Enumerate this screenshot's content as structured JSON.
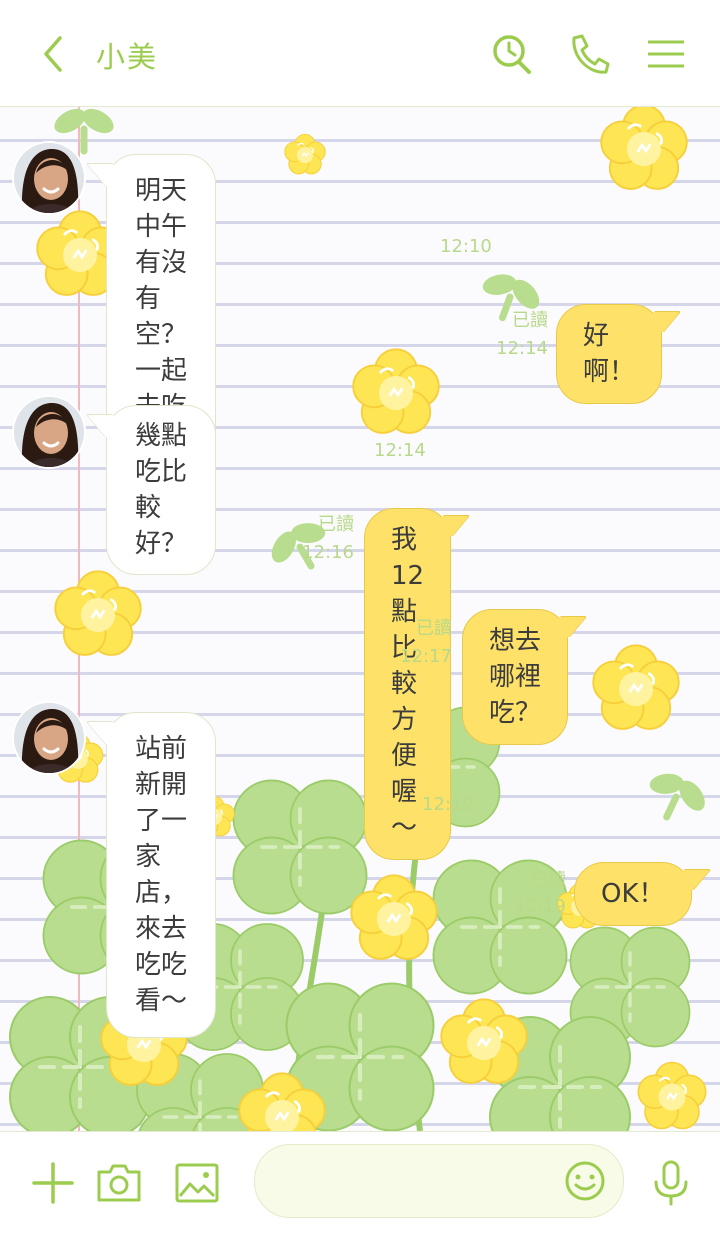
{
  "header": {
    "title": "小美",
    "back_icon": "chevron-left-icon",
    "search_icon": "search-clock-icon",
    "call_icon": "phone-icon",
    "menu_icon": "hamburger-menu-icon"
  },
  "messages": [
    {
      "from": "friend",
      "text": "明天中午有沒有空？\n一起去吃好吃的吧～",
      "time": "12:10"
    },
    {
      "from": "me",
      "text": "好啊！",
      "read": "已讀",
      "time": "12:14"
    },
    {
      "from": "friend",
      "text": "幾點吃比較好？",
      "time": "12:14"
    },
    {
      "from": "me",
      "text": "我12點比較方便喔～",
      "read": "已讀",
      "time": "12:16"
    },
    {
      "from": "me",
      "text": "想去哪裡吃？",
      "read": "已讀",
      "time": "12:17"
    },
    {
      "from": "friend",
      "text": "站前新開了一家店，\n來去吃吃看～",
      "time": "12:19"
    },
    {
      "from": "me",
      "text": "OK！",
      "read": "已讀",
      "time": "12:19"
    }
  ],
  "footer": {
    "plus_icon": "plus-icon",
    "camera_icon": "camera-icon",
    "image_icon": "image-icon",
    "emoji_icon": "smiley-icon",
    "mic_icon": "microphone-icon",
    "input_value": ""
  },
  "colors": {
    "accent": "#9ccc4e",
    "outgoing_bubble": "#fde169",
    "incoming_bubble": "#ffffff",
    "meta_text": "#b9d98a",
    "flower": "#fde553",
    "leaf": "#b9dd8e"
  }
}
